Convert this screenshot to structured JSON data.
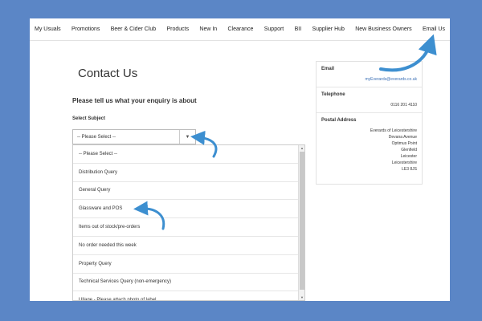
{
  "nav": {
    "items": [
      "My Usuals",
      "Promotions",
      "Beer & Cider Club",
      "Products",
      "New In",
      "Clearance",
      "Support",
      "BII",
      "Supplier Hub",
      "New Business Owners",
      "Email Us"
    ]
  },
  "page": {
    "title": "Contact Us",
    "subtitle": "Please tell us what your enquiry is about",
    "select_label": "Select Subject"
  },
  "select": {
    "value": "-- Please Select --",
    "options": [
      "-- Please Select --",
      "Distribution Query",
      "General Query",
      "Glassware and POS",
      "Items out of stock/pre-orders",
      "No order needed this week",
      "Property Query",
      "Technical Services Query (non-emergency)",
      "Ullage - Please attach photo of label"
    ]
  },
  "contact": {
    "email_label": "Email",
    "email": "myEverards@everards.co.uk",
    "telephone_label": "Telephone",
    "telephone": "0116 201 4110",
    "address_label": "Postal Address",
    "address_lines": [
      "Everards of Leicestershire",
      "Devana Avenue",
      "Optimus Point",
      "Glenfield",
      "Leicester",
      "Leicestershire",
      "LE3 8JS"
    ]
  },
  "colors": {
    "background": "#5b86c6",
    "arrow": "#3d8fd0",
    "link": "#3a6fb5"
  },
  "icons": {
    "select_arrow": "caret-down-icon",
    "annotation": "curved-arrow-icon"
  }
}
